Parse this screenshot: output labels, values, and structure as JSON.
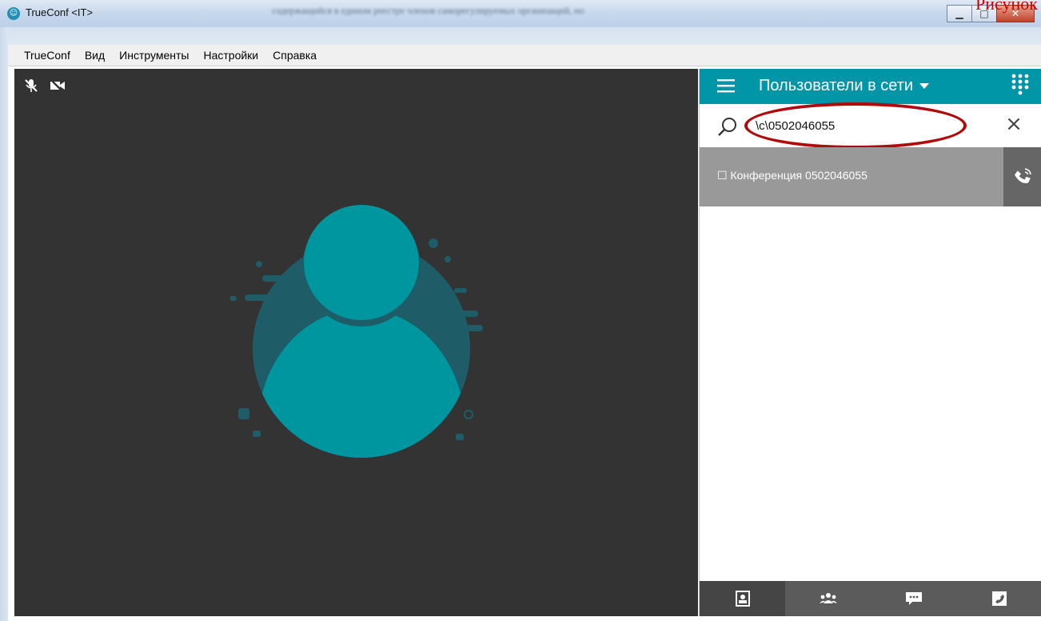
{
  "doc": {
    "corner_text": "Рисунок"
  },
  "window": {
    "title": "TrueConf <IT>",
    "icon": "trueconf-logo-icon",
    "background_text": "содержащийся в едином реестре членов саморегулируемых организаций, но",
    "controls": [
      "minimize-icon",
      "maximize-icon",
      "close-icon"
    ]
  },
  "menu": {
    "items": [
      {
        "label": "TrueConf"
      },
      {
        "label": "Вид"
      },
      {
        "label": "Инструменты"
      },
      {
        "label": "Настройки"
      },
      {
        "label": "Справка"
      }
    ]
  },
  "video": {
    "icons": [
      "mic-off-icon",
      "camera-off-icon"
    ],
    "avatar": "user-avatar-icon"
  },
  "panel": {
    "title": "Пользователи в сети",
    "search": {
      "value": "\\c\\0502046055",
      "placeholder": ""
    },
    "results": [
      {
        "label": "☐ Конференция 0502046055"
      }
    ],
    "bottom_tabs": [
      "contacts-icon",
      "groups-icon",
      "chat-icon",
      "call-icon"
    ]
  },
  "colors": {
    "accent": "#0096a8",
    "avatar_teal": "#00969f",
    "video_bg": "#333333",
    "highlight": "#b00a0a"
  }
}
